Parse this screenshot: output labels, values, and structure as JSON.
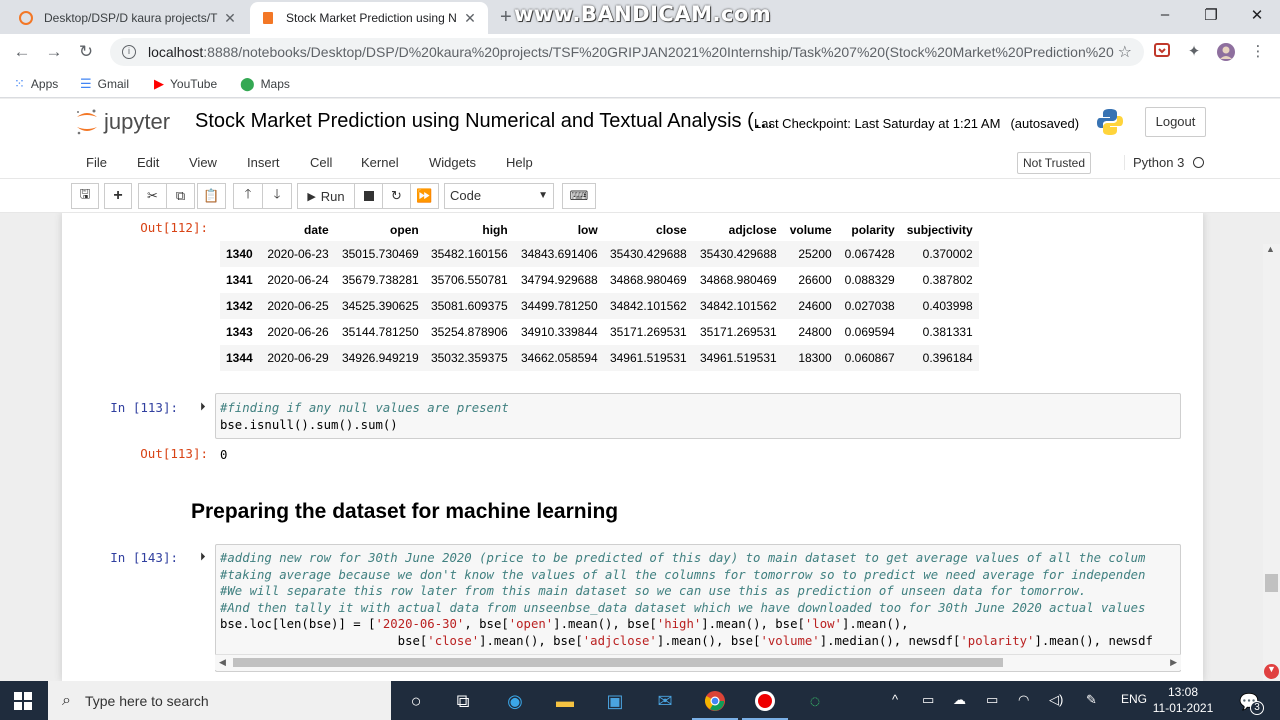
{
  "browser": {
    "tabs": [
      {
        "title": "Desktop/DSP/D kaura projects/T"
      },
      {
        "title": "Stock Market Prediction using N"
      }
    ],
    "new_tab_symbol": "+",
    "watermark": "www.BANDICAM.com",
    "url_host": "localhost",
    "url_path": ":8888/notebooks/Desktop/DSP/D%20kaura%20projects/TSF%20GRIPJAN2021%20Internship/Task%207%20(Stock%20Market%20Prediction%20u...",
    "bookmarks": [
      {
        "label": "Apps",
        "icon": "apps-grid-icon"
      },
      {
        "label": "Gmail",
        "icon": "gmail-icon"
      },
      {
        "label": "YouTube",
        "icon": "youtube-icon"
      },
      {
        "label": "Maps",
        "icon": "maps-pin-icon"
      }
    ]
  },
  "jupyter": {
    "logo_text": "jupyter",
    "notebook_title": "Stock Market Prediction using Numerical and Textual Analysis (…",
    "checkpoint": "Last Checkpoint: Last Saturday at 1:21 AM",
    "autosave": "(autosaved)",
    "logout_label": "Logout",
    "menus": [
      "File",
      "Edit",
      "View",
      "Insert",
      "Cell",
      "Kernel",
      "Widgets",
      "Help"
    ],
    "trust_label": "Not Trusted",
    "kernel_name": "Python 3",
    "run_label": "Run",
    "cell_type": "Code"
  },
  "output_112": {
    "prompt": "Out[112]:",
    "columns": [
      "",
      "date",
      "open",
      "high",
      "low",
      "close",
      "adjclose",
      "volume",
      "polarity",
      "subjectivity"
    ],
    "rows": [
      [
        "1340",
        "2020-06-23",
        "35015.730469",
        "35482.160156",
        "34843.691406",
        "35430.429688",
        "35430.429688",
        "25200",
        "0.067428",
        "0.370002"
      ],
      [
        "1341",
        "2020-06-24",
        "35679.738281",
        "35706.550781",
        "34794.929688",
        "34868.980469",
        "34868.980469",
        "26600",
        "0.088329",
        "0.387802"
      ],
      [
        "1342",
        "2020-06-25",
        "34525.390625",
        "35081.609375",
        "34499.781250",
        "34842.101562",
        "34842.101562",
        "24600",
        "0.027038",
        "0.403998"
      ],
      [
        "1343",
        "2020-06-26",
        "35144.781250",
        "35254.878906",
        "34910.339844",
        "35171.269531",
        "35171.269531",
        "24800",
        "0.069594",
        "0.381331"
      ],
      [
        "1344",
        "2020-06-29",
        "34926.949219",
        "35032.359375",
        "34662.058594",
        "34961.519531",
        "34961.519531",
        "18300",
        "0.060867",
        "0.396184"
      ]
    ]
  },
  "cell_113": {
    "in_prompt": "In [113]:",
    "line1": "#finding if any null values are present",
    "line2": "bse.isnull().sum().sum()",
    "out_prompt": "Out[113]:",
    "output": "0"
  },
  "markdown_heading": "Preparing the dataset for machine learning",
  "cell_143": {
    "in_prompt": "In [143]:",
    "comment1": "#adding new row for 30th June 2020 (price to be predicted of this day) to main dataset to get average values of all the colum",
    "comment2": "#taking average because we don't know the values of all the columns for tomorrow so to predict we need average for independen",
    "comment3": "#We will separate this row later from this main dataset so we can use this as prediction of unseen data for tomorrow.",
    "comment4": "#And then tally it with actual data from unseenbse_data dataset which we have downloaded too for 30th June 2020 actual values",
    "c5a": "bse.loc[len(bse)] = [",
    "s_date": "'2020-06-30'",
    "c5b": ", bse[",
    "s_open": "'open'",
    "c5c": "].mean(), bse[",
    "s_high": "'high'",
    "c5d": "].mean(), bse[",
    "s_low": "'low'",
    "c5e": "].mean(),",
    "c6a": "                        bse[",
    "s_close": "'close'",
    "c6b": "].mean(), bse[",
    "s_adjclose": "'adjclose'",
    "c6c": "].mean(), bse[",
    "s_volume": "'volume'",
    "c6d": "].median(), newsdf[",
    "s_polarity": "'polarity'",
    "c6e": "].mean(), newsdf"
  },
  "taskbar": {
    "search_placeholder": "Type here to search",
    "language": "ENG",
    "time": "13:08",
    "date": "11-01-2021",
    "notification_count": "3"
  },
  "colors": {
    "in_prompt": "#303f9f",
    "out_prompt": "#d84315",
    "comment": "#408080",
    "string": "#ba2121",
    "taskbar": "#1f2c3d"
  }
}
